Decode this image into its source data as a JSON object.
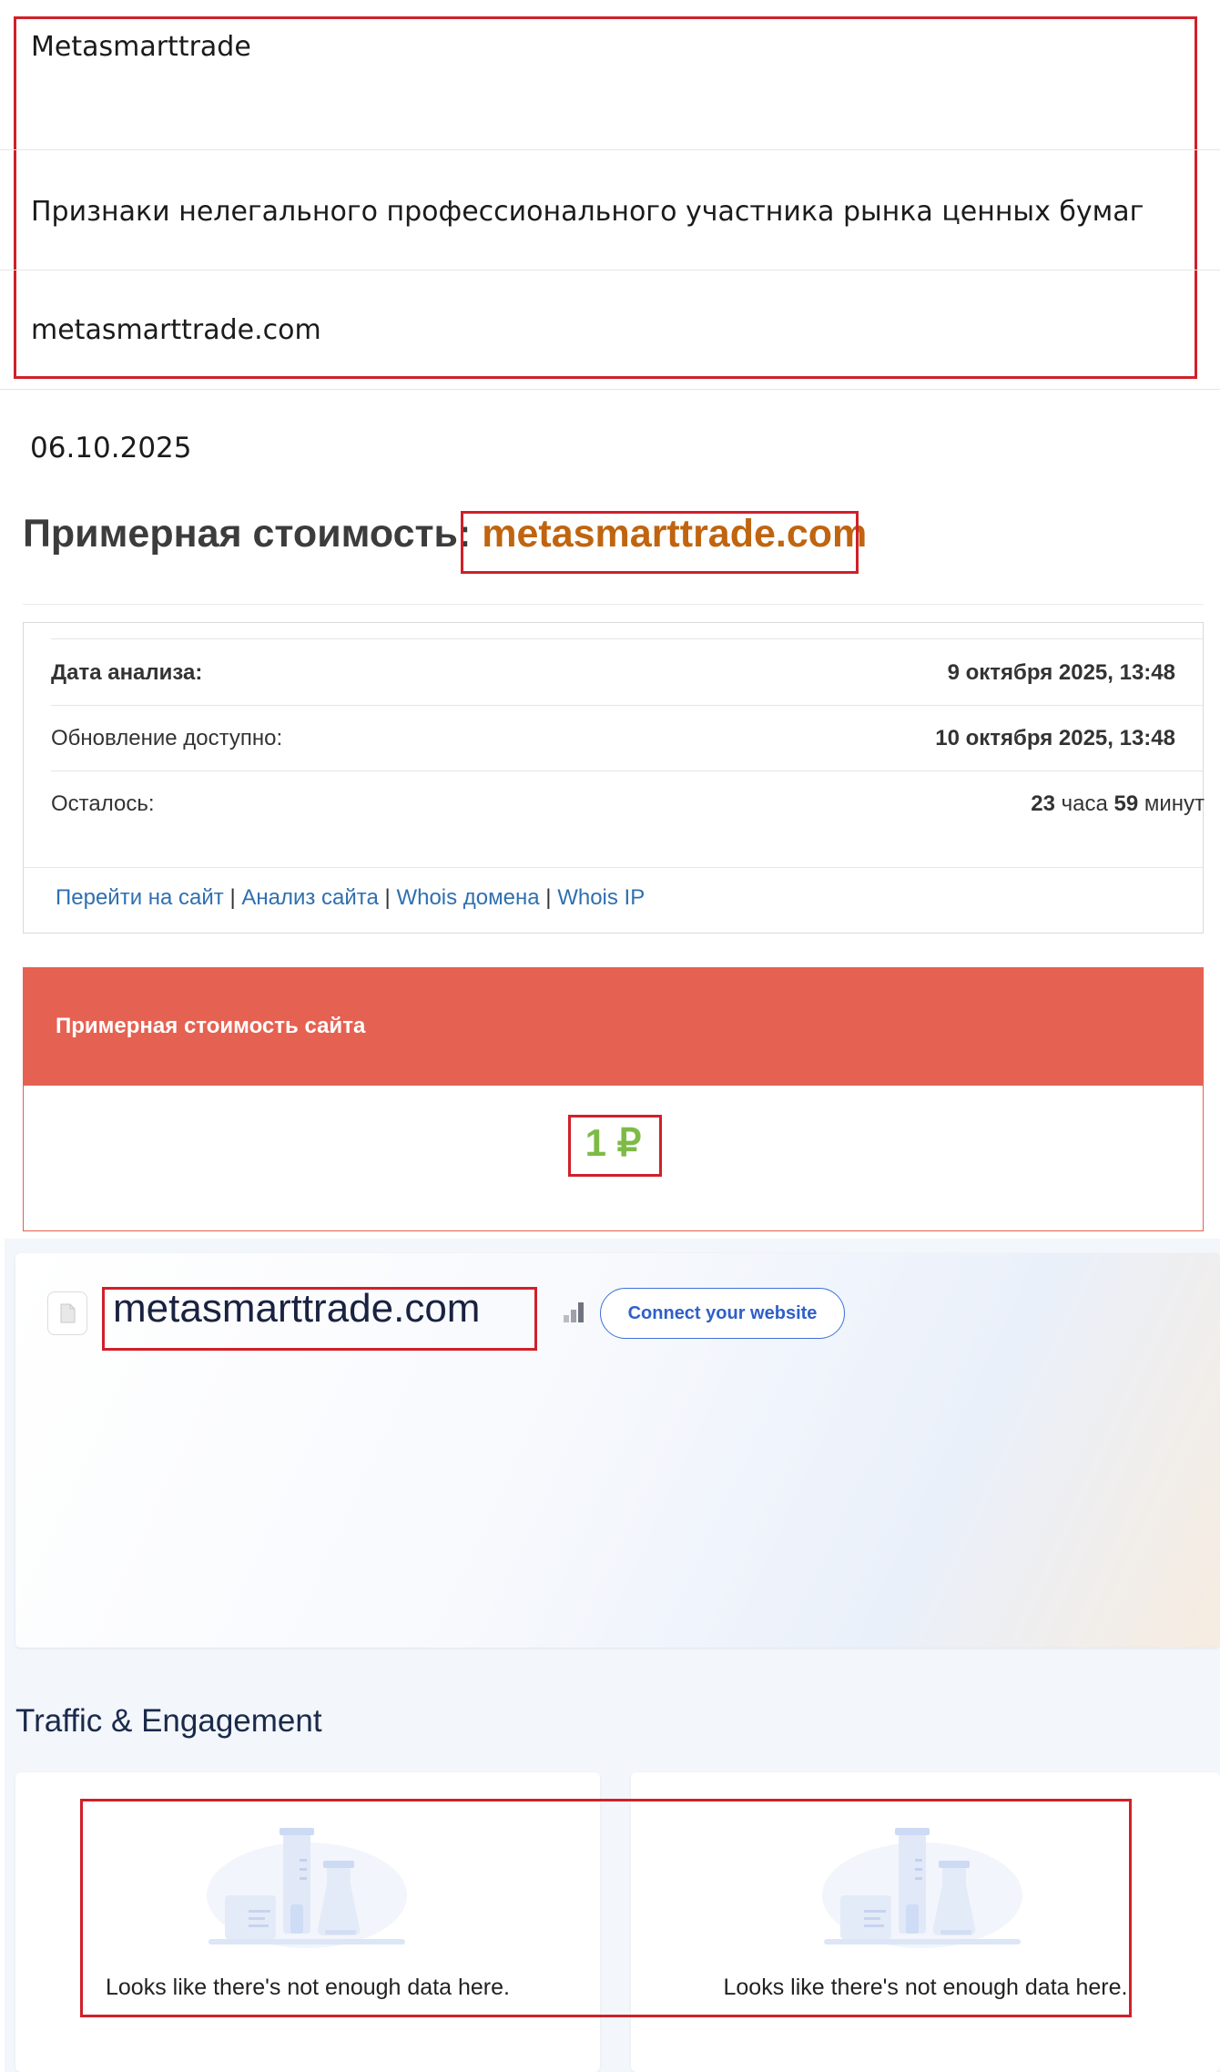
{
  "registry": {
    "name": "Metasmarttrade",
    "category": "Признаки нелегального профессионального участника рынка ценных бумаг",
    "domain": "metasmarttrade.com",
    "date": "06.10.2025"
  },
  "valuation": {
    "headline_prefix": "Примерная стоимость:",
    "headline_domain": "metasmarttrade.com",
    "rows": [
      {
        "label": "Дата анализа:",
        "value": "9 октября 2025, 13:48"
      },
      {
        "label": "Обновление доступно:",
        "value": "10 октября 2025, 13:48"
      },
      {
        "label": "Осталось:",
        "hours_num": "23",
        "hours_word": "часа",
        "minutes_num": "59",
        "minutes_word": "минут"
      }
    ],
    "links": [
      "Перейти на сайт",
      "Анализ сайта",
      "Whois домена",
      "Whois IP"
    ],
    "separator": "|",
    "cost_title": "Примерная стоимость сайта",
    "cost_value": "1 ₽"
  },
  "similarweb": {
    "domain": "metasmarttrade.com",
    "connect_label": "Connect your website",
    "section_title": "Traffic & Engagement",
    "empty_message_left": "Looks like there's not enough data here.",
    "empty_message_right": "Looks like there's not enough data here."
  },
  "colors": {
    "highlight_border": "#d0202a",
    "headline_domain": "#c0640f",
    "cost_header": "#e56151",
    "cost_value": "#7dbb46",
    "link": "#2f6fb1",
    "connect_button": "#3d6fd6"
  }
}
